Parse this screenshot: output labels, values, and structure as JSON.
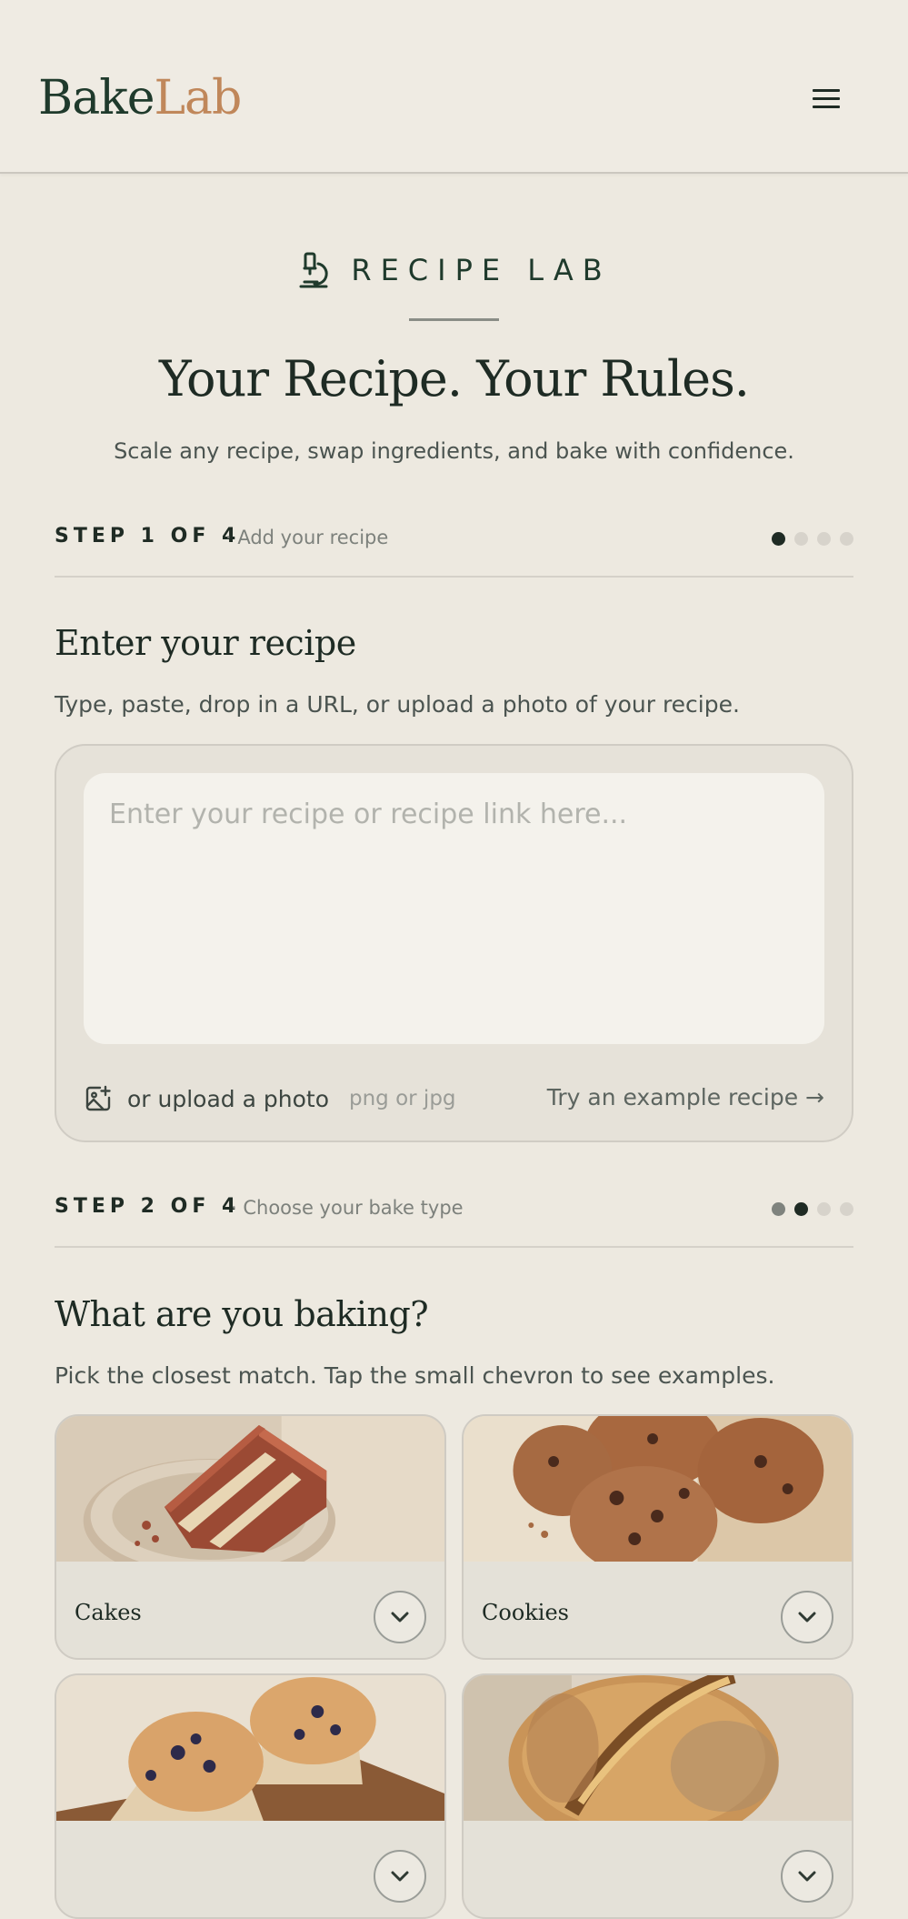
{
  "header": {
    "logo_part1": "Bake",
    "logo_part2": "Lab",
    "menu_icon": "hamburger-menu-icon"
  },
  "hero": {
    "eyebrow": "RECIPE LAB",
    "eyebrow_icon": "microscope-icon",
    "title": "Your Recipe. Your Rules.",
    "subtitle": "Scale any recipe, swap ingredients, and bake with confidence."
  },
  "step1": {
    "label": "STEP 1 OF 4",
    "desc": "· Add your recipe",
    "dots": [
      "active",
      "",
      "",
      ""
    ],
    "title": "Enter your recipe",
    "subtitle": "Type, paste, drop in a URL, or upload a photo of your recipe.",
    "placeholder": "Enter your recipe or recipe link here...",
    "upload_label": "or upload a photo",
    "upload_hint": "png or jpg",
    "upload_icon": "image-plus-icon",
    "example_link": "Try an example recipe →"
  },
  "step2": {
    "label": "STEP 2 OF 4",
    "desc": "· Choose your bake type",
    "dots": [
      "done",
      "active",
      "",
      ""
    ],
    "title": "What are you baking?",
    "subtitle": "Pick the closest match. Tap the small chevron to see examples.",
    "cards": [
      {
        "name": "Cakes"
      },
      {
        "name": "Cookies"
      },
      {
        "name": ""
      },
      {
        "name": ""
      }
    ]
  },
  "colors": {
    "background": "#ede9e0",
    "brand_dark": "#1f3a2c",
    "brand_accent": "#c0875a"
  }
}
